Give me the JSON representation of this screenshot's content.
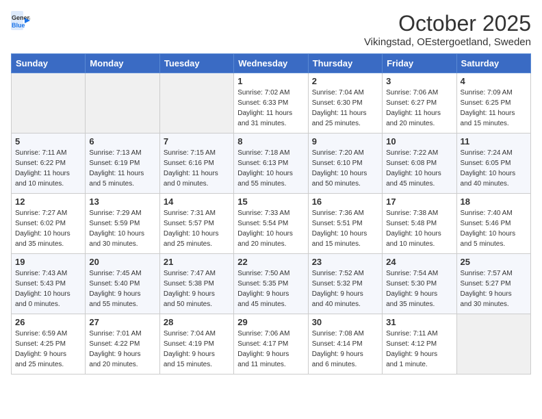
{
  "header": {
    "logo_line1": "General",
    "logo_line2": "Blue",
    "month": "October 2025",
    "location": "Vikingstad, OEstergoetland, Sweden"
  },
  "days_of_week": [
    "Sunday",
    "Monday",
    "Tuesday",
    "Wednesday",
    "Thursday",
    "Friday",
    "Saturday"
  ],
  "weeks": [
    [
      {
        "day": "",
        "info": ""
      },
      {
        "day": "",
        "info": ""
      },
      {
        "day": "",
        "info": ""
      },
      {
        "day": "1",
        "info": "Sunrise: 7:02 AM\nSunset: 6:33 PM\nDaylight: 11 hours\nand 31 minutes."
      },
      {
        "day": "2",
        "info": "Sunrise: 7:04 AM\nSunset: 6:30 PM\nDaylight: 11 hours\nand 25 minutes."
      },
      {
        "day": "3",
        "info": "Sunrise: 7:06 AM\nSunset: 6:27 PM\nDaylight: 11 hours\nand 20 minutes."
      },
      {
        "day": "4",
        "info": "Sunrise: 7:09 AM\nSunset: 6:25 PM\nDaylight: 11 hours\nand 15 minutes."
      }
    ],
    [
      {
        "day": "5",
        "info": "Sunrise: 7:11 AM\nSunset: 6:22 PM\nDaylight: 11 hours\nand 10 minutes."
      },
      {
        "day": "6",
        "info": "Sunrise: 7:13 AM\nSunset: 6:19 PM\nDaylight: 11 hours\nand 5 minutes."
      },
      {
        "day": "7",
        "info": "Sunrise: 7:15 AM\nSunset: 6:16 PM\nDaylight: 11 hours\nand 0 minutes."
      },
      {
        "day": "8",
        "info": "Sunrise: 7:18 AM\nSunset: 6:13 PM\nDaylight: 10 hours\nand 55 minutes."
      },
      {
        "day": "9",
        "info": "Sunrise: 7:20 AM\nSunset: 6:10 PM\nDaylight: 10 hours\nand 50 minutes."
      },
      {
        "day": "10",
        "info": "Sunrise: 7:22 AM\nSunset: 6:08 PM\nDaylight: 10 hours\nand 45 minutes."
      },
      {
        "day": "11",
        "info": "Sunrise: 7:24 AM\nSunset: 6:05 PM\nDaylight: 10 hours\nand 40 minutes."
      }
    ],
    [
      {
        "day": "12",
        "info": "Sunrise: 7:27 AM\nSunset: 6:02 PM\nDaylight: 10 hours\nand 35 minutes."
      },
      {
        "day": "13",
        "info": "Sunrise: 7:29 AM\nSunset: 5:59 PM\nDaylight: 10 hours\nand 30 minutes."
      },
      {
        "day": "14",
        "info": "Sunrise: 7:31 AM\nSunset: 5:57 PM\nDaylight: 10 hours\nand 25 minutes."
      },
      {
        "day": "15",
        "info": "Sunrise: 7:33 AM\nSunset: 5:54 PM\nDaylight: 10 hours\nand 20 minutes."
      },
      {
        "day": "16",
        "info": "Sunrise: 7:36 AM\nSunset: 5:51 PM\nDaylight: 10 hours\nand 15 minutes."
      },
      {
        "day": "17",
        "info": "Sunrise: 7:38 AM\nSunset: 5:48 PM\nDaylight: 10 hours\nand 10 minutes."
      },
      {
        "day": "18",
        "info": "Sunrise: 7:40 AM\nSunset: 5:46 PM\nDaylight: 10 hours\nand 5 minutes."
      }
    ],
    [
      {
        "day": "19",
        "info": "Sunrise: 7:43 AM\nSunset: 5:43 PM\nDaylight: 10 hours\nand 0 minutes."
      },
      {
        "day": "20",
        "info": "Sunrise: 7:45 AM\nSunset: 5:40 PM\nDaylight: 9 hours\nand 55 minutes."
      },
      {
        "day": "21",
        "info": "Sunrise: 7:47 AM\nSunset: 5:38 PM\nDaylight: 9 hours\nand 50 minutes."
      },
      {
        "day": "22",
        "info": "Sunrise: 7:50 AM\nSunset: 5:35 PM\nDaylight: 9 hours\nand 45 minutes."
      },
      {
        "day": "23",
        "info": "Sunrise: 7:52 AM\nSunset: 5:32 PM\nDaylight: 9 hours\nand 40 minutes."
      },
      {
        "day": "24",
        "info": "Sunrise: 7:54 AM\nSunset: 5:30 PM\nDaylight: 9 hours\nand 35 minutes."
      },
      {
        "day": "25",
        "info": "Sunrise: 7:57 AM\nSunset: 5:27 PM\nDaylight: 9 hours\nand 30 minutes."
      }
    ],
    [
      {
        "day": "26",
        "info": "Sunrise: 6:59 AM\nSunset: 4:25 PM\nDaylight: 9 hours\nand 25 minutes."
      },
      {
        "day": "27",
        "info": "Sunrise: 7:01 AM\nSunset: 4:22 PM\nDaylight: 9 hours\nand 20 minutes."
      },
      {
        "day": "28",
        "info": "Sunrise: 7:04 AM\nSunset: 4:19 PM\nDaylight: 9 hours\nand 15 minutes."
      },
      {
        "day": "29",
        "info": "Sunrise: 7:06 AM\nSunset: 4:17 PM\nDaylight: 9 hours\nand 11 minutes."
      },
      {
        "day": "30",
        "info": "Sunrise: 7:08 AM\nSunset: 4:14 PM\nDaylight: 9 hours\nand 6 minutes."
      },
      {
        "day": "31",
        "info": "Sunrise: 7:11 AM\nSunset: 4:12 PM\nDaylight: 9 hours\nand 1 minute."
      },
      {
        "day": "",
        "info": ""
      }
    ]
  ]
}
